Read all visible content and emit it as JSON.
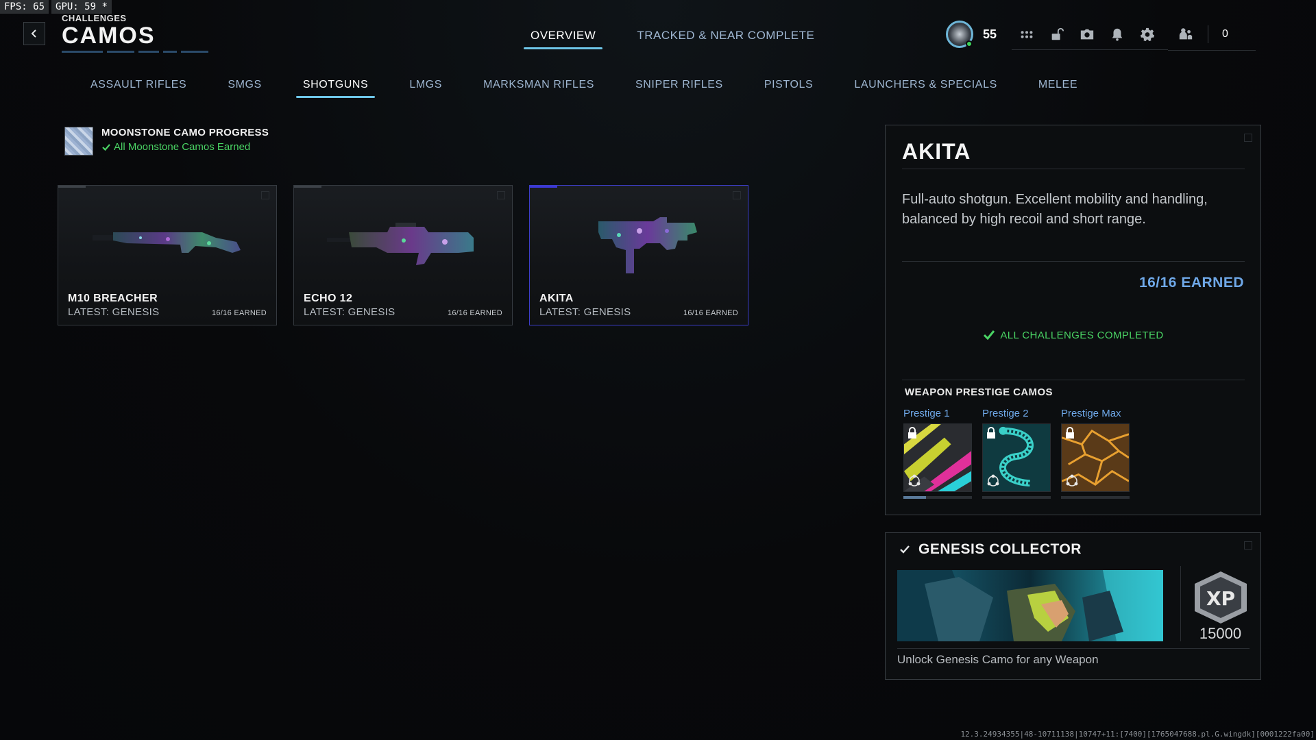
{
  "perf": {
    "fps": "FPS:  65",
    "gpu": "GPU: 59 *"
  },
  "header": {
    "supertitle": "CHALLENGES",
    "title": "CAMOS"
  },
  "top_tabs": [
    {
      "label": "OVERVIEW",
      "active": true
    },
    {
      "label": "TRACKED & NEAR COMPLETE",
      "active": false
    }
  ],
  "hud": {
    "level": "55",
    "friends_count": "0"
  },
  "category_tabs": [
    {
      "label": "ASSAULT RIFLES",
      "active": false
    },
    {
      "label": "SMGS",
      "active": false
    },
    {
      "label": "SHOTGUNS",
      "active": true
    },
    {
      "label": "LMGS",
      "active": false
    },
    {
      "label": "MARKSMAN RIFLES",
      "active": false
    },
    {
      "label": "SNIPER RIFLES",
      "active": false
    },
    {
      "label": "PISTOLS",
      "active": false
    },
    {
      "label": "LAUNCHERS & SPECIALS",
      "active": false
    },
    {
      "label": "MELEE",
      "active": false
    }
  ],
  "moonstone": {
    "title": "MOONSTONE CAMO PROGRESS",
    "status": "All Moonstone Camos Earned"
  },
  "weapons": [
    {
      "name": "M10 BREACHER",
      "latest": "LATEST: GENESIS",
      "earned": "16/16 EARNED",
      "selected": false
    },
    {
      "name": "ECHO 12",
      "latest": "LATEST: GENESIS",
      "earned": "16/16 EARNED",
      "selected": false
    },
    {
      "name": "AKITA",
      "latest": "LATEST: GENESIS",
      "earned": "16/16 EARNED",
      "selected": true
    }
  ],
  "detail": {
    "name": "AKITA",
    "description": "Full-auto shotgun. Excellent mobility and handling, balanced by high recoil and short range.",
    "earned": "16/16 EARNED",
    "complete": "ALL CHALLENGES COMPLETED",
    "prestige_header": "WEAPON PRESTIGE CAMOS",
    "prestige": [
      {
        "label": "Prestige 1",
        "progress": 0.33
      },
      {
        "label": "Prestige 2",
        "progress": 0
      },
      {
        "label": "Prestige Max",
        "progress": 0
      }
    ]
  },
  "collector": {
    "title": "GENESIS COLLECTOR",
    "xp_label": "XP",
    "xp": "15000",
    "description": "Unlock Genesis Camo for any Weapon"
  },
  "build": "12.3.24934355|48-10711138|10747+11:[7400][1765047688.pl.G.wingdk][0001222fa00]",
  "colors": {
    "accent": "#6ec6e8",
    "selected_border": "#3d3ec9",
    "success": "#4ad464",
    "earned": "#6fa8e8"
  }
}
